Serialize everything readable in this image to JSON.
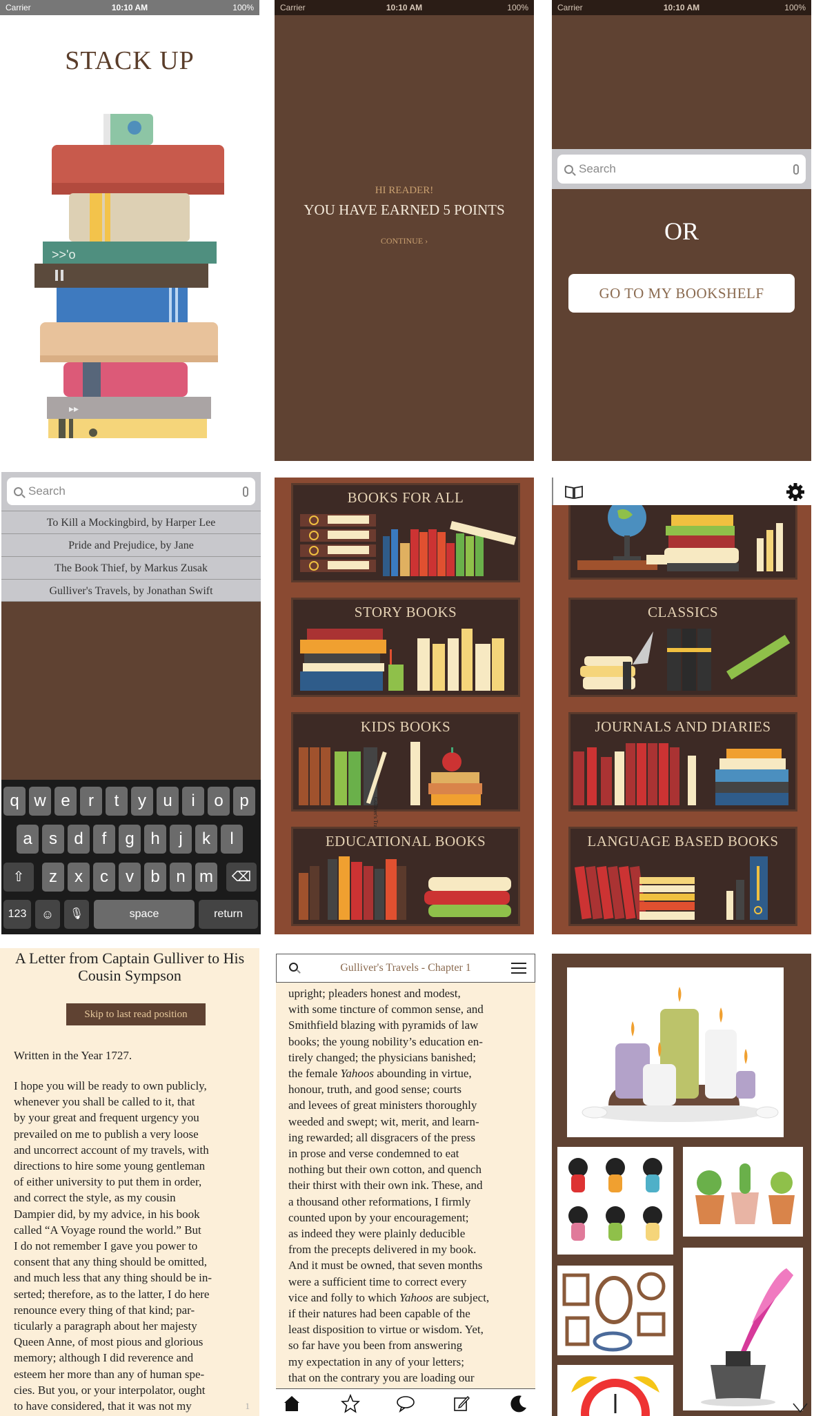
{
  "status": {
    "carrier": "Carrier",
    "time": "10:10 AM",
    "battery": "100%"
  },
  "splash": {
    "title": "STACK UP"
  },
  "points": {
    "greeting": "HI READER!",
    "message": "YOU HAVE EARNED 5 POINTS",
    "continue": "CONTINUE ›"
  },
  "search_screen": {
    "search_placeholder": "Search",
    "or_label": "OR",
    "bookshelf_button": "GO TO MY BOOKSHELF"
  },
  "results": {
    "search_placeholder": "Search",
    "items": [
      "To Kill a Mockingbird, by Harper Lee",
      "Pride and Prejudice, by Jane",
      "The Book Thief, by Markus Zusak",
      "Gulliver's Travels, by Jonathan Swift"
    ]
  },
  "keyboard": {
    "row1": [
      "q",
      "w",
      "e",
      "r",
      "t",
      "y",
      "u",
      "i",
      "o",
      "p"
    ],
    "row2": [
      "a",
      "s",
      "d",
      "f",
      "g",
      "h",
      "j",
      "k",
      "l"
    ],
    "row3": [
      "z",
      "x",
      "c",
      "v",
      "b",
      "n",
      "m"
    ],
    "num": "123",
    "space": "space",
    "return": "return"
  },
  "categories_left": [
    "BOOKS FOR ALL",
    "STORY BOOKS",
    "KIDS BOOKS",
    "EDUCATIONAL BOOKS"
  ],
  "categories_right": [
    "CLASSICS",
    "JOURNALS AND DIARIES",
    "LANGUAGE BASED BOOKS"
  ],
  "kids_spine": "Gulliver's Travels Jonathan Swift",
  "letter": {
    "title": "A Letter from Captain Gulliver to His Cousin Sympson",
    "skip_button": "Skip to last read position",
    "year_line": "Written in the Year 1727.",
    "lines": [
      "I hope you will be ready to own publicly,",
      "whenever you shall be called to it, that",
      "by your great and frequent urgency you",
      "prevailed on me to publish a very loose",
      "and uncorrect account of my travels, with",
      "directions to hire some young gentleman",
      "of either university to put them in order,",
      "and correct the style, as my cousin",
      "Dampier did, by my advice, in his book",
      "called “A Voyage round the world.” But",
      "I do not remember I gave you power to",
      "consent that any thing should be omitted,",
      "and much less that any thing should be in-",
      "serted; therefore, as to the latter, I do here",
      "renounce every thing of that kind; par-",
      "ticularly a paragraph about her majesty",
      "Queen Anne, of most pious and glorious",
      "memory; although I did reverence and",
      "esteem her more than any of human spe-",
      "cies. But you, or your interpolator, ought",
      "to have considered, that it was not my"
    ],
    "page": "1"
  },
  "reader": {
    "chapter": "Gulliver's Travels - Chapter 1",
    "lines": [
      [
        "upright; pleaders honest and modest,"
      ],
      [
        "with some tincture of common sense, and"
      ],
      [
        "Smithfield blazing with pyramids of law"
      ],
      [
        "books; the young nobility’s education en-"
      ],
      [
        "tirely changed; the physicians banished;"
      ],
      [
        "the female ",
        "Yahoos",
        " abounding in virtue,"
      ],
      [
        "honour, truth, and good sense; courts"
      ],
      [
        "and levees of great ministers thoroughly"
      ],
      [
        "weeded and swept; wit, merit, and learn-"
      ],
      [
        "ing rewarded; all disgracers of the press"
      ],
      [
        "in prose and verse condemned to eat"
      ],
      [
        "nothing but their own cotton, and quench"
      ],
      [
        "their thirst with their own ink. These, and"
      ],
      [
        "a thousand other reformations, I firmly"
      ],
      [
        "counted upon by your encouragement;"
      ],
      [
        "as indeed they were plainly deducible"
      ],
      [
        "from the precepts delivered in my book."
      ],
      [
        "And it must be owned, that seven months"
      ],
      [
        "were a sufficient time to correct every"
      ],
      [
        "vice and folly to which ",
        "Yahoos",
        " are subject,"
      ],
      [
        "if their natures had been capable of the"
      ],
      [
        "least disposition to virtue or wisdom. Yet,"
      ],
      [
        "so far have you been from answering"
      ],
      [
        "my expectation in any of your letters;"
      ],
      [
        "that on the contrary you are loading our"
      ]
    ]
  },
  "colors": {
    "brown": "#5f4232",
    "cream": "#fcefd9",
    "shelf": "#3d2a25",
    "shelf_frame": "#8a4a32"
  }
}
